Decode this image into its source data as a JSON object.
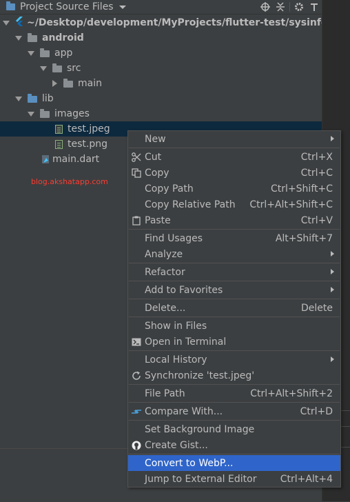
{
  "header": {
    "title": "Project Source Files"
  },
  "tree": {
    "root": "~/Desktop/development/MyProjects/flutter-test/sysinfo",
    "android": "android",
    "app": "app",
    "src": "src",
    "main": "main",
    "lib": "lib",
    "images": "images",
    "test_jpeg": "test.jpeg",
    "test_png": "test.png",
    "main_dart": "main.dart"
  },
  "watermark": "blog.akshatapp.com",
  "menu": {
    "new": "New",
    "cut": "Cut",
    "cut_sc": "Ctrl+X",
    "copy": "Copy",
    "copy_sc": "Ctrl+C",
    "copy_path": "Copy Path",
    "copy_path_sc": "Ctrl+Shift+C",
    "copy_rel": "Copy Relative Path",
    "copy_rel_sc": "Ctrl+Alt+Shift+C",
    "paste": "Paste",
    "paste_sc": "Ctrl+V",
    "find_usages": "Find Usages",
    "find_usages_sc": "Alt+Shift+7",
    "analyze": "Analyze",
    "refactor": "Refactor",
    "favorites": "Add to Favorites",
    "delete": "Delete...",
    "delete_sc": "Delete",
    "show_files": "Show in Files",
    "open_terminal": "Open in Terminal",
    "local_history": "Local History",
    "synchronize": "Synchronize 'test.jpeg'",
    "file_path": "File Path",
    "file_path_sc": "Ctrl+Alt+Shift+2",
    "compare": "Compare With...",
    "compare_sc": "Ctrl+D",
    "bg_image": "Set Background Image",
    "gist": "Create Gist...",
    "webp": "Convert to WebP...",
    "external": "Jump to External Editor",
    "external_sc": "Ctrl+Alt+4"
  },
  "colors": {
    "background": "#3c3f41",
    "selection": "#0d293e",
    "menu_highlight": "#2f65ca",
    "watermark": "#ff3b30"
  }
}
